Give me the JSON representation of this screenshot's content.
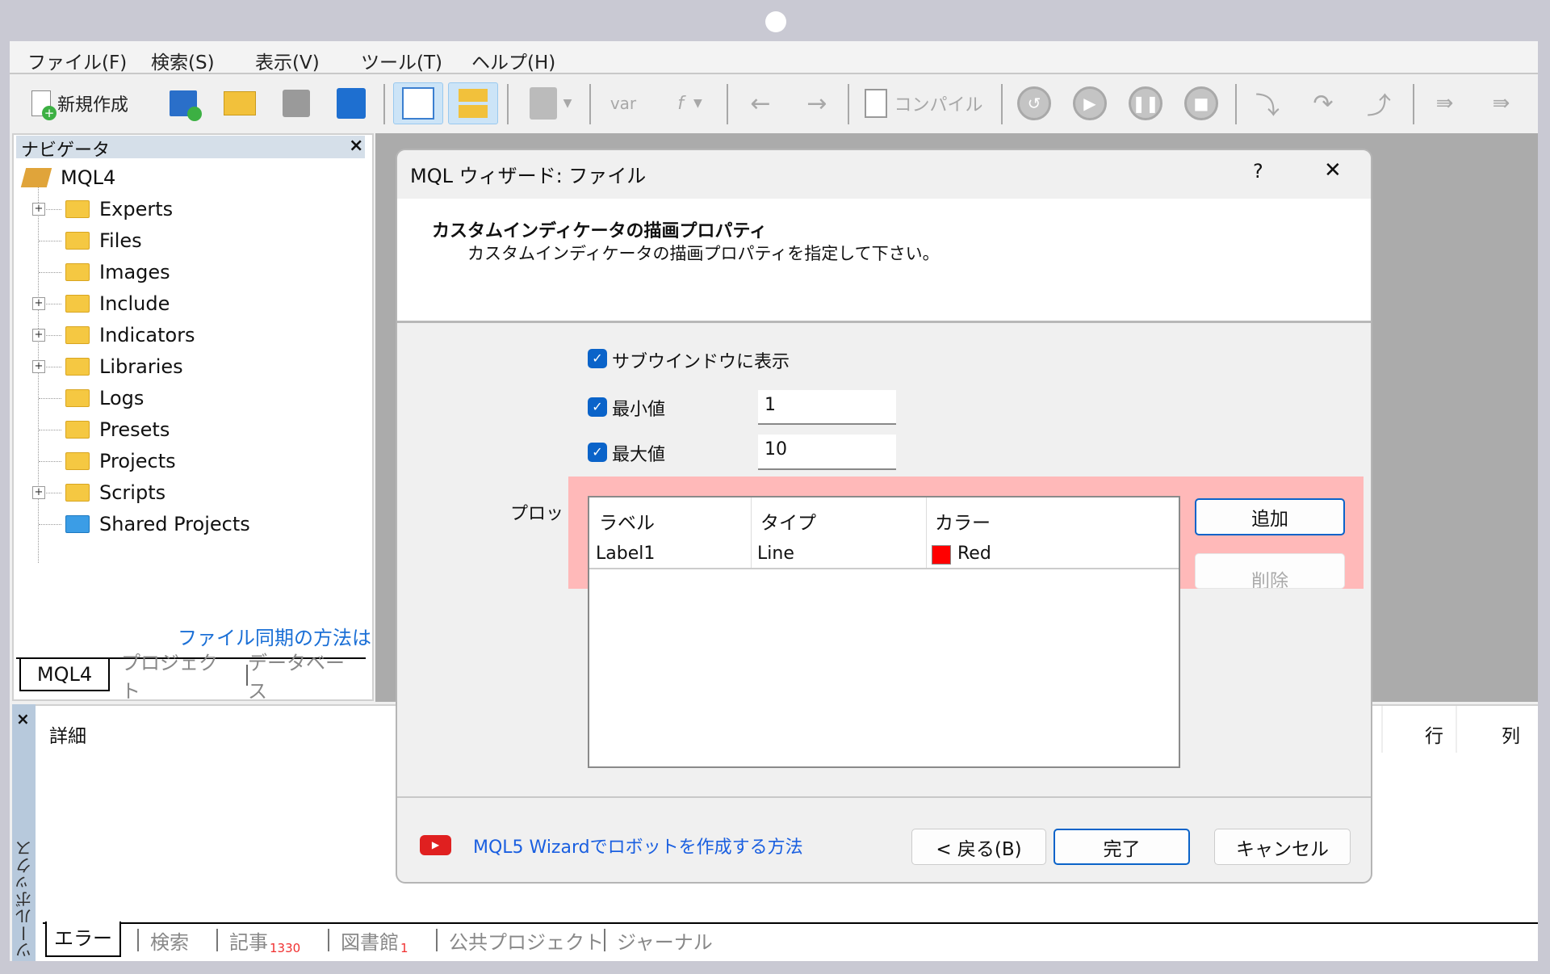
{
  "menu": [
    "ファイル(F)",
    "検索(S)",
    "表示(V)",
    "ツール(T)",
    "ヘルプ(H)"
  ],
  "toolbar": {
    "new_label": "新規作成",
    "var_label": "var",
    "f_label": "f",
    "compile_label": "コンパイル"
  },
  "navigator": {
    "title": "ナビゲータ",
    "close": "×",
    "root": "MQL4",
    "items": [
      {
        "label": "Experts",
        "expandable": true
      },
      {
        "label": "Files",
        "expandable": false
      },
      {
        "label": "Images",
        "expandable": false
      },
      {
        "label": "Include",
        "expandable": true
      },
      {
        "label": "Indicators",
        "expandable": true
      },
      {
        "label": "Libraries",
        "expandable": true
      },
      {
        "label": "Logs",
        "expandable": false
      },
      {
        "label": "Presets",
        "expandable": false
      },
      {
        "label": "Projects",
        "expandable": false
      },
      {
        "label": "Scripts",
        "expandable": true
      },
      {
        "label": "Shared Projects",
        "expandable": false
      }
    ],
    "sync_link": "ファイル同期の方法は",
    "tabs": [
      "MQL4",
      "プロジェクト",
      "データベース"
    ]
  },
  "toolbox": {
    "title": "ツールボックス",
    "close": "×",
    "columns": [
      "詳細",
      "行",
      "列"
    ],
    "tabs": [
      {
        "label": "エラー",
        "badge": ""
      },
      {
        "label": "検索",
        "badge": ""
      },
      {
        "label": "記事",
        "badge": "1330"
      },
      {
        "label": "図書館",
        "badge": "1"
      },
      {
        "label": "公共プロジェクト",
        "badge": ""
      },
      {
        "label": "ジャーナル",
        "badge": ""
      }
    ]
  },
  "dialog": {
    "title": "MQL ウィザード: ファイル",
    "help": "?",
    "close": "✕",
    "heading": "カスタムインディケータの描画プロパティ",
    "subheading": "カスタムインディケータの描画プロパティを指定して下さい。",
    "subwindow_label": "サブウインドウに表示",
    "subwindow_checked": true,
    "min_label": "最小値",
    "min_checked": true,
    "min_value": "1",
    "max_label": "最大値",
    "max_checked": true,
    "max_value": "10",
    "plots_label": "プロット:",
    "table": {
      "headers": [
        "ラベル",
        "タイプ",
        "カラー"
      ],
      "rows": [
        {
          "label": "Label1",
          "type": "Line",
          "color": "Red",
          "swatch": "#ff0000"
        }
      ]
    },
    "add_button": "追加",
    "delete_button": "削除",
    "video_link": "MQL5 Wizardでロボットを作成する方法",
    "back_button": "< 戻る(B)",
    "finish_button": "完了",
    "cancel_button": "キャンセル"
  },
  "colors": {
    "accent": "#0a63c9",
    "highlight": "#ffb9b9",
    "link": "#1a5fe0"
  }
}
